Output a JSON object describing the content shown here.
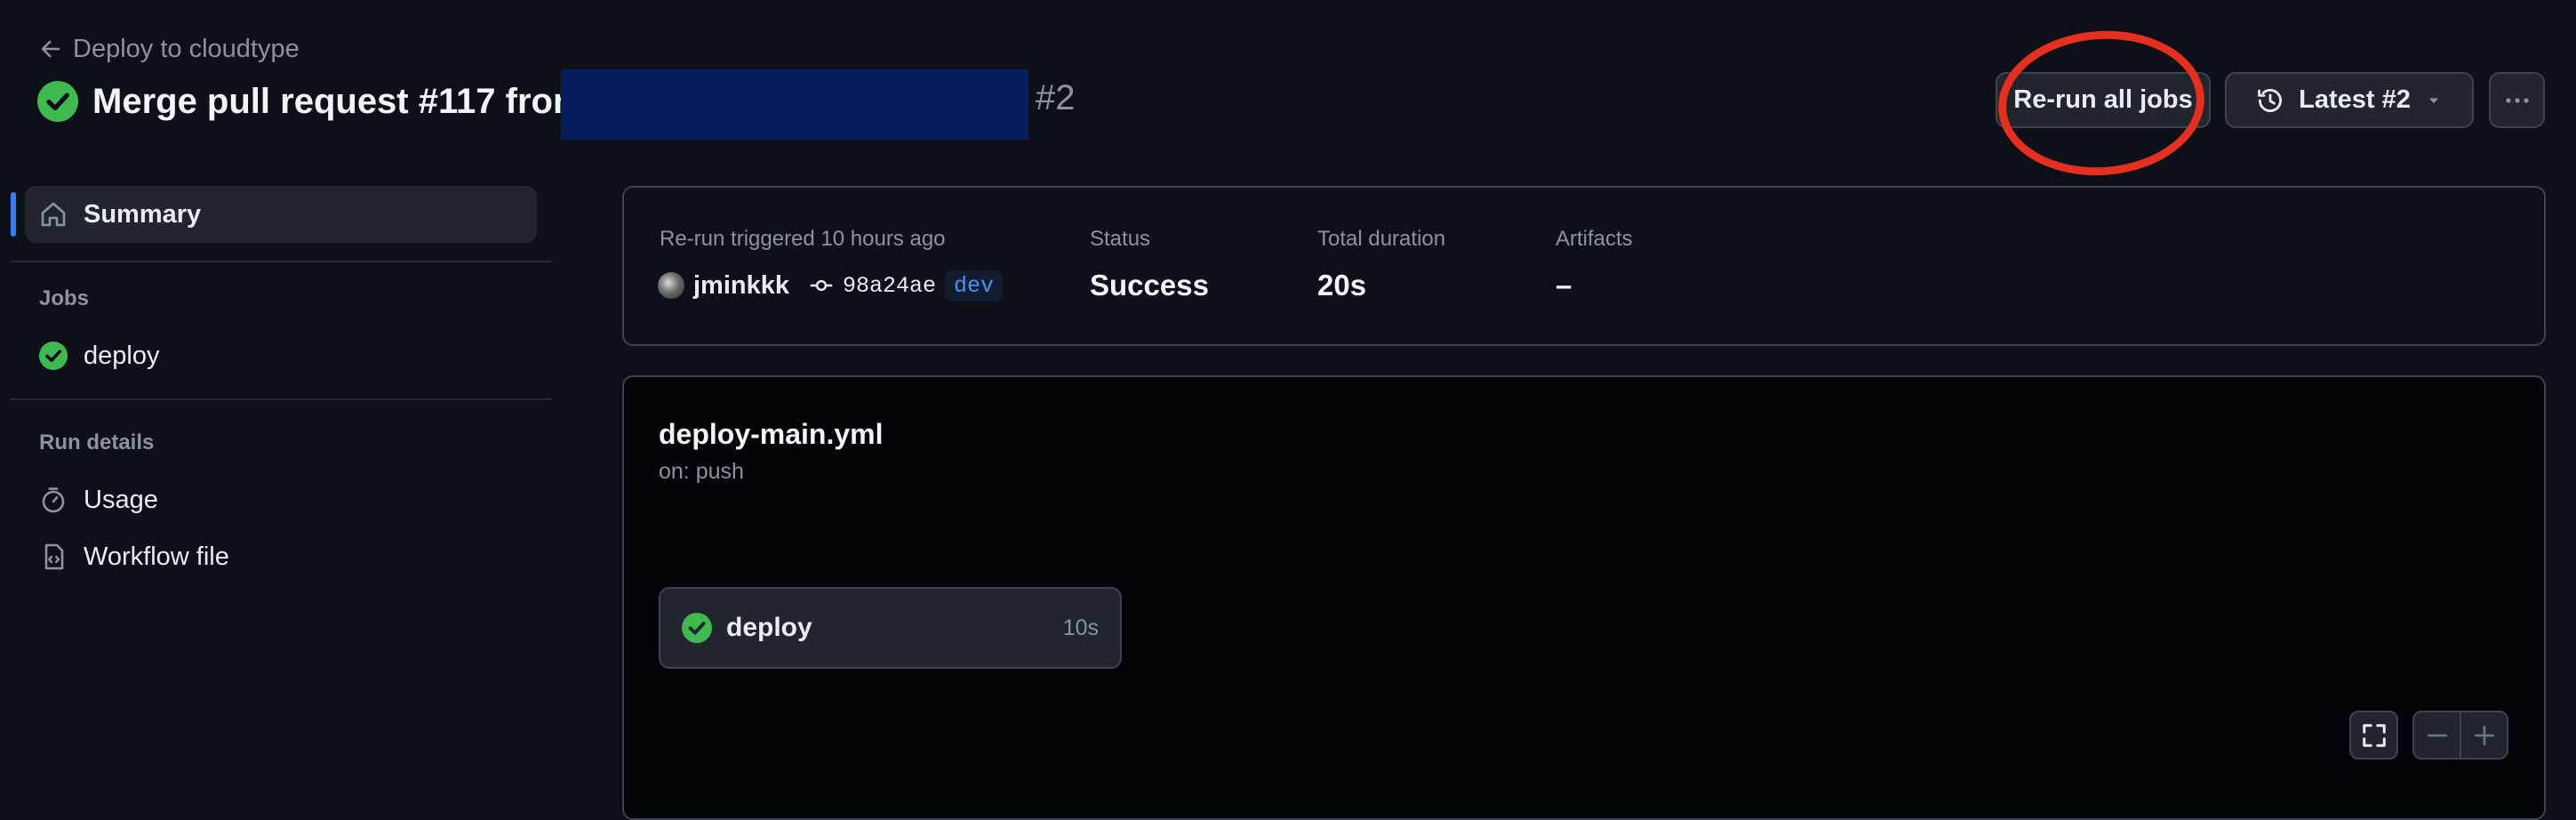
{
  "header": {
    "back_label": "Deploy to cloudtype",
    "title": "Merge pull request #117 from",
    "run_number": "#2",
    "rerun_label": "Re-run all jobs",
    "attempt_label": "Latest #2"
  },
  "sidebar": {
    "summary_label": "Summary",
    "jobs_heading": "Jobs",
    "jobs": [
      {
        "label": "deploy"
      }
    ],
    "run_details_heading": "Run details",
    "details": [
      {
        "label": "Usage"
      },
      {
        "label": "Workflow file"
      }
    ]
  },
  "summary": {
    "trigger_label": "Re-run triggered 10 hours ago",
    "actor": "jminkkk",
    "commit": "98a24ae",
    "branch": "dev",
    "status_label": "Status",
    "status_value": "Success",
    "duration_label": "Total duration",
    "duration_value": "20s",
    "artifacts_label": "Artifacts",
    "artifacts_value": "–"
  },
  "workflow": {
    "file": "deploy-main.yml",
    "trigger": "on: push",
    "job": {
      "name": "deploy",
      "duration": "10s"
    }
  },
  "colors": {
    "success": "#3fb950",
    "accent": "#2f81f7",
    "annotation": "#e5301f"
  }
}
